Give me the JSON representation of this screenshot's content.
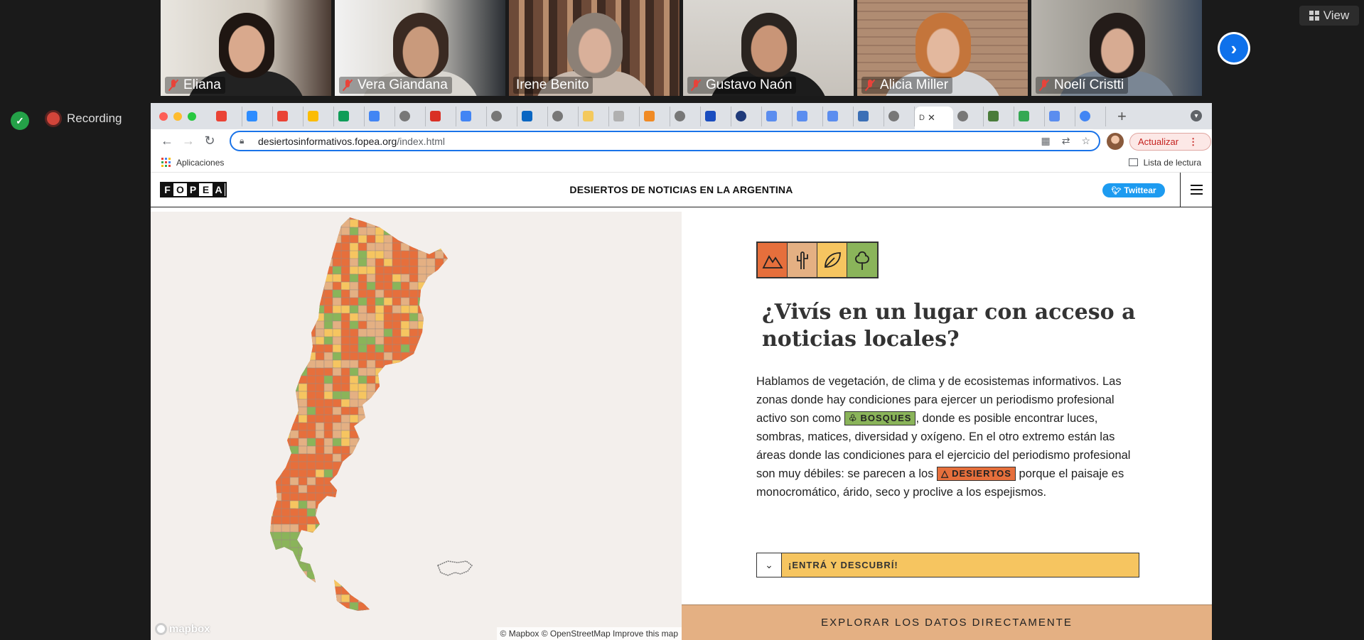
{
  "zoom": {
    "participants": [
      {
        "name": "Eliana",
        "muted": true,
        "active": false
      },
      {
        "name": "Vera Giandana",
        "muted": true,
        "active": false
      },
      {
        "name": "Irene Benito",
        "muted": false,
        "active": true
      },
      {
        "name": "Gustavo Naón",
        "muted": true,
        "active": false
      },
      {
        "name": "Alicia Miller",
        "muted": true,
        "active": false
      },
      {
        "name": "Noelí Cristti",
        "muted": true,
        "active": false
      }
    ],
    "view_label": "View",
    "recording_label": "Recording",
    "next_icon": "chevron-right-icon"
  },
  "browser": {
    "active_tab_title": "D",
    "url_host": "desiertosinformativos.fopea.org",
    "url_path": "/index.html",
    "update_label": "Actualizar",
    "bookmarks_apps_label": "Aplicaciones",
    "reading_list_label": "Lista de lectura"
  },
  "site": {
    "logo_letters": [
      "F",
      "O",
      "P",
      "E",
      "A"
    ],
    "title": "DESIERTOS DE NOTICIAS EN LA ARGENTINA",
    "tweet_label": "Twittear",
    "headline": "¿Vivís en un lugar con acceso a noticias locales?",
    "body": {
      "part1": "Hablamos de vegetación, de clima y de ecosistemas informativos. Las zonas donde hay condiciones para ejercer un periodismo profesional activo son como ",
      "tag_forest": "BOSQUES",
      "part2": ", donde es posible encontrar luces, sombras, matices, diversidad y oxígeno. En el otro extremo están las áreas donde las condiciones para el ejercicio del periodismo profesional son muy débiles: se parecen a los ",
      "tag_desert": "DESIERTOS",
      "part3": " porque el paisaje es monocromático, árido, seco y proclive a los espejismos."
    },
    "discover_label": "¡ENTRÁ Y DESCUBRÍ!",
    "explore_label": "EXPLORAR LOS DATOS DIRECTAMENTE",
    "mapbox_logo": "mapbox",
    "map_attribution": "© Mapbox © OpenStreetMap Improve this map",
    "colors": {
      "desert": "#e66f3c",
      "semi_desert": "#e4b083",
      "semi_forest": "#f6c560",
      "forest": "#8ab45a"
    }
  }
}
